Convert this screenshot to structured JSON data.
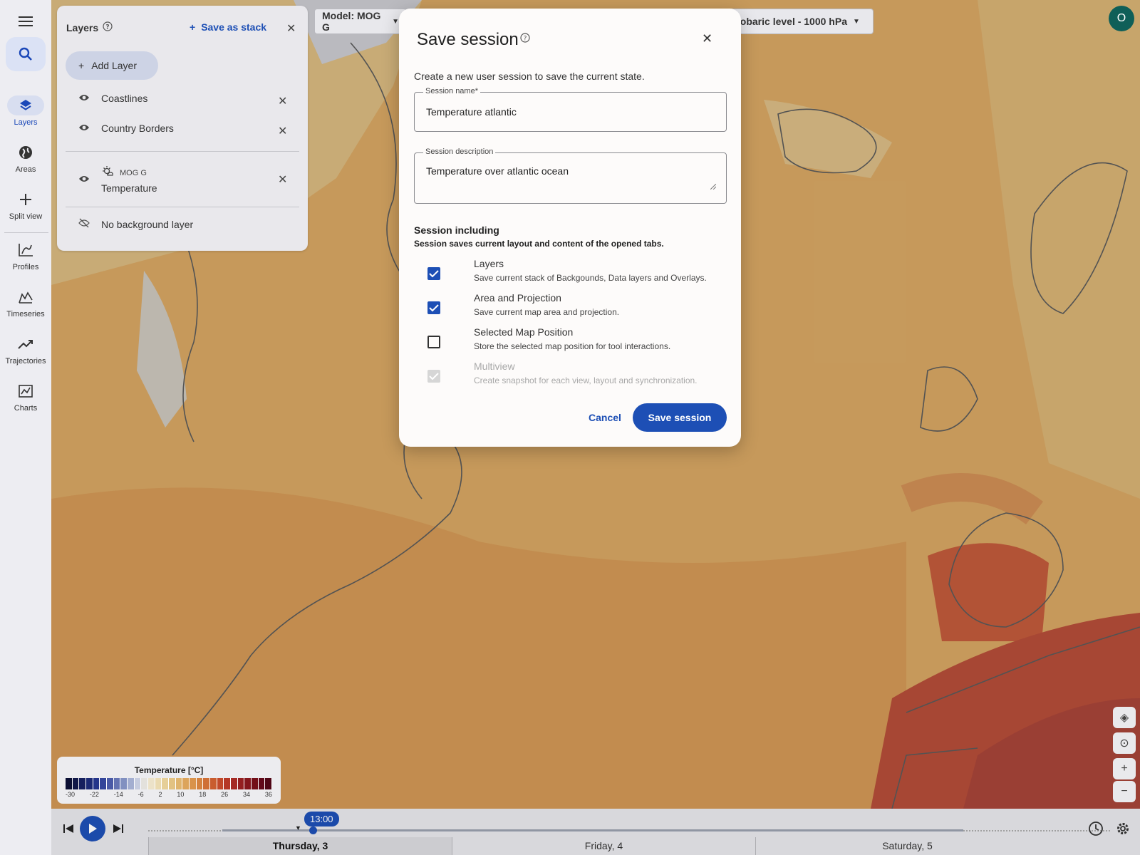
{
  "rail": {
    "items": [
      {
        "label": "Layers"
      },
      {
        "label": "Areas"
      },
      {
        "label": "Split view"
      },
      {
        "label": "Profiles"
      },
      {
        "label": "Timeseries"
      },
      {
        "label": "Trajectories"
      },
      {
        "label": "Charts"
      }
    ]
  },
  "topbar": {
    "model_label": "Model: MOG G",
    "level_label": "sobaric level - 1000 hPa",
    "avatar_initial": "O"
  },
  "layers_panel": {
    "title": "Layers",
    "save_stack_label": "Save as stack",
    "add_layer_label": "Add Layer",
    "layers": [
      {
        "name": "Coastlines"
      },
      {
        "name": "Country Borders"
      }
    ],
    "data_layer": {
      "model": "MOG G",
      "name": "Temperature"
    },
    "background_label": "No background layer"
  },
  "legend": {
    "title": "Temperature [°C]",
    "ticks": [
      "-30",
      "-22",
      "-14",
      "-6",
      "2",
      "10",
      "18",
      "26",
      "34",
      "36"
    ]
  },
  "timeline": {
    "current_time": "13:00",
    "days": [
      "Thursday, 3",
      "Friday, 4",
      "Saturday, 5"
    ]
  },
  "dialog": {
    "title": "Save session",
    "subtitle": "Create a new user session to save the current state.",
    "name_label": "Session name*",
    "name_value": "Temperature atlantic",
    "desc_label": "Session description",
    "desc_value": "Temperature over atlantic ocean",
    "section_title": "Session including",
    "section_subtitle": "Session saves current layout and content of the opened tabs.",
    "options": [
      {
        "title": "Layers",
        "desc": "Save current stack of Backgounds, Data layers and Overlays.",
        "checked": true
      },
      {
        "title": "Area and Projection",
        "desc": "Save current map area and projection.",
        "checked": true
      },
      {
        "title": "Selected Map Position",
        "desc": "Store the selected map position for tool interactions.",
        "checked": false
      },
      {
        "title": "Multiview",
        "desc": "Create snapshot for each view, layout and synchronization.",
        "checked": true,
        "disabled": true
      }
    ],
    "cancel_label": "Cancel",
    "save_label": "Save session"
  },
  "colors": {
    "accent": "#1d4fb5",
    "avatar": "#0f5f58"
  }
}
